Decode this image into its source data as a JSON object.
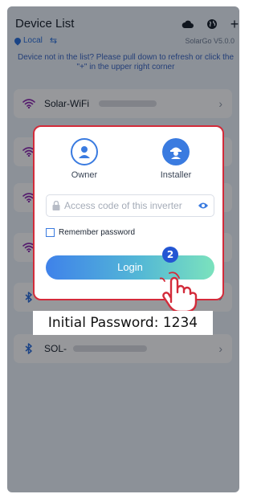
{
  "header": {
    "title": "Device List",
    "icons": [
      "cloud-icon",
      "globe-icon",
      "plus-icon"
    ],
    "location": "Local",
    "version": "SolarGo V5.0.0"
  },
  "hint": "Device not in the list? Please pull down to refresh or click the \"+\" in the upper right corner",
  "devices": [
    {
      "type": "wifi",
      "name": "Solar-WiFi"
    },
    {
      "type": "wifi",
      "name": ""
    },
    {
      "type": "wifi",
      "name": ""
    },
    {
      "type": "wifi",
      "name": ""
    },
    {
      "type": "bluetooth",
      "name": "SOL-"
    },
    {
      "type": "bluetooth",
      "name": "SOL-"
    }
  ],
  "dialog": {
    "roles": [
      {
        "label": "Owner",
        "selected": false
      },
      {
        "label": "Installer",
        "selected": true
      }
    ],
    "code_placeholder": "Access code of this inverter",
    "remember_label": "Remember password",
    "remember_checked": false,
    "login_label": "Login"
  },
  "step_number": "2",
  "callout": "Initial Password: 1234",
  "colors": {
    "accent": "#3a7be0",
    "highlight_border": "#d32b3a",
    "wifi": "#8a2fb0",
    "bluetooth": "#2f6fd8",
    "step_badge": "#2356d3"
  }
}
